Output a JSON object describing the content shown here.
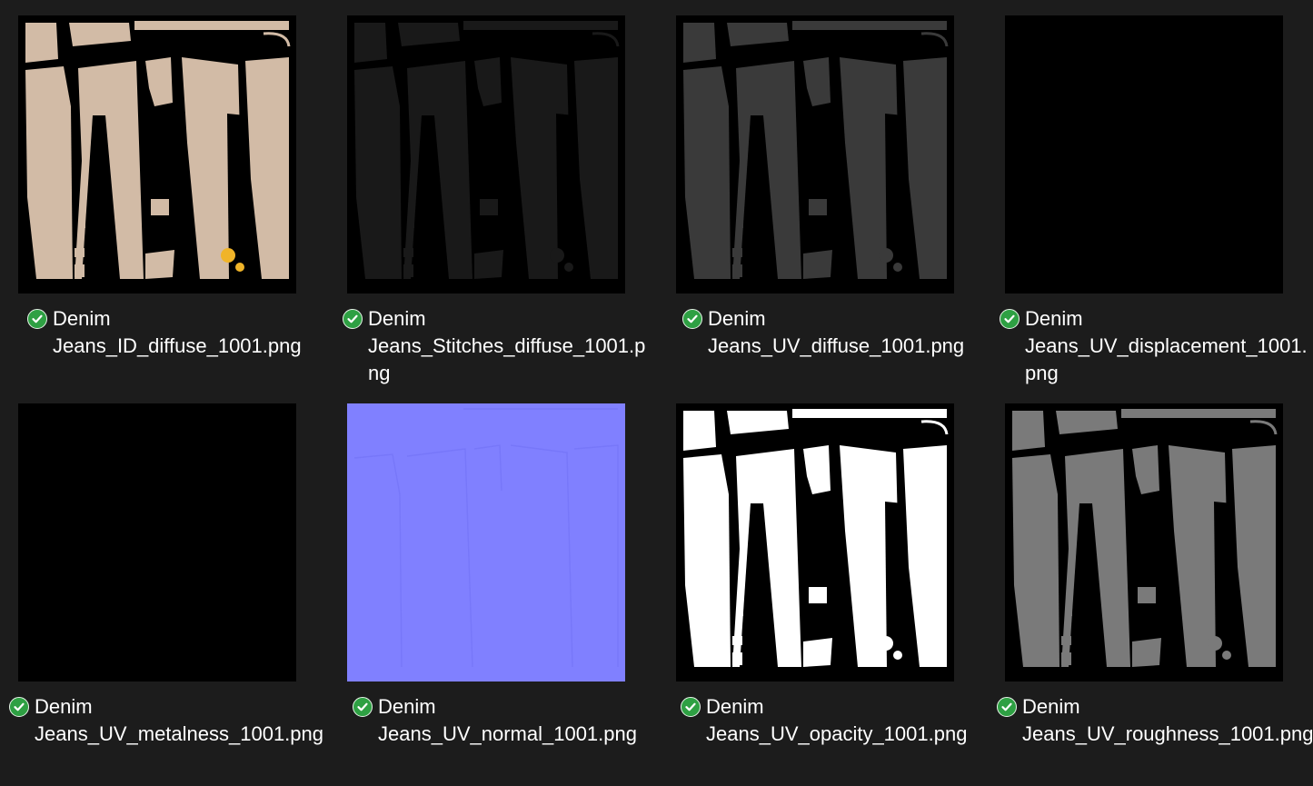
{
  "files": [
    {
      "line1": "Denim",
      "line2": "Jeans_ID_diffuse_1001.png",
      "line3": "",
      "status": "synced",
      "icon": "green-check-icon"
    },
    {
      "line1": "Denim",
      "line2": "Jeans_Stitches_diffuse_1001.p",
      "line3": "ng",
      "status": "synced",
      "icon": "green-check-icon"
    },
    {
      "line1": "Denim",
      "line2": "Jeans_UV_diffuse_1001.png",
      "line3": "",
      "status": "synced",
      "icon": "green-check-icon"
    },
    {
      "line1": "Denim",
      "line2": "Jeans_UV_displacement_1001.",
      "line3": "png",
      "status": "synced",
      "icon": "green-check-icon"
    },
    {
      "line1": "Denim",
      "line2": "Jeans_UV_metalness_1001.png",
      "line3": "",
      "status": "synced",
      "icon": "green-check-icon"
    },
    {
      "line1": "Denim",
      "line2": "Jeans_UV_normal_1001.png",
      "line3": "",
      "status": "synced",
      "icon": "green-check-icon"
    },
    {
      "line1": "Denim",
      "line2": "Jeans_UV_opacity_1001.png",
      "line3": "",
      "status": "synced",
      "icon": "green-check-icon"
    },
    {
      "line1": "Denim",
      "line2": "Jeans_UV_roughness_1001.png",
      "line3": "",
      "status": "synced",
      "icon": "green-check-icon"
    }
  ],
  "colors": {
    "background": "#1c1c1c",
    "status_check": "#2ea043",
    "id_fill": "#d2bba6",
    "id_accent": "#f0b429",
    "stitches_fill": "#191919",
    "uv_diffuse_fill": "#3a3a3a",
    "normal_fill": "#8080ff",
    "opacity_fill": "#ffffff",
    "roughness_fill": "#7a7a7a"
  }
}
